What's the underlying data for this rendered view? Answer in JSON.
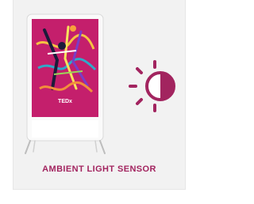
{
  "feature": {
    "caption": "AMBIENT LIGHT SENSOR",
    "icon": "brightness-icon",
    "device_icon": "digital-a-board-stand-icon"
  },
  "poster": {
    "logo_text": "TEDx"
  },
  "colors": {
    "accent": "#a2245f",
    "poster_background": "#c41f6c",
    "card_background": "#f2f2f2"
  }
}
